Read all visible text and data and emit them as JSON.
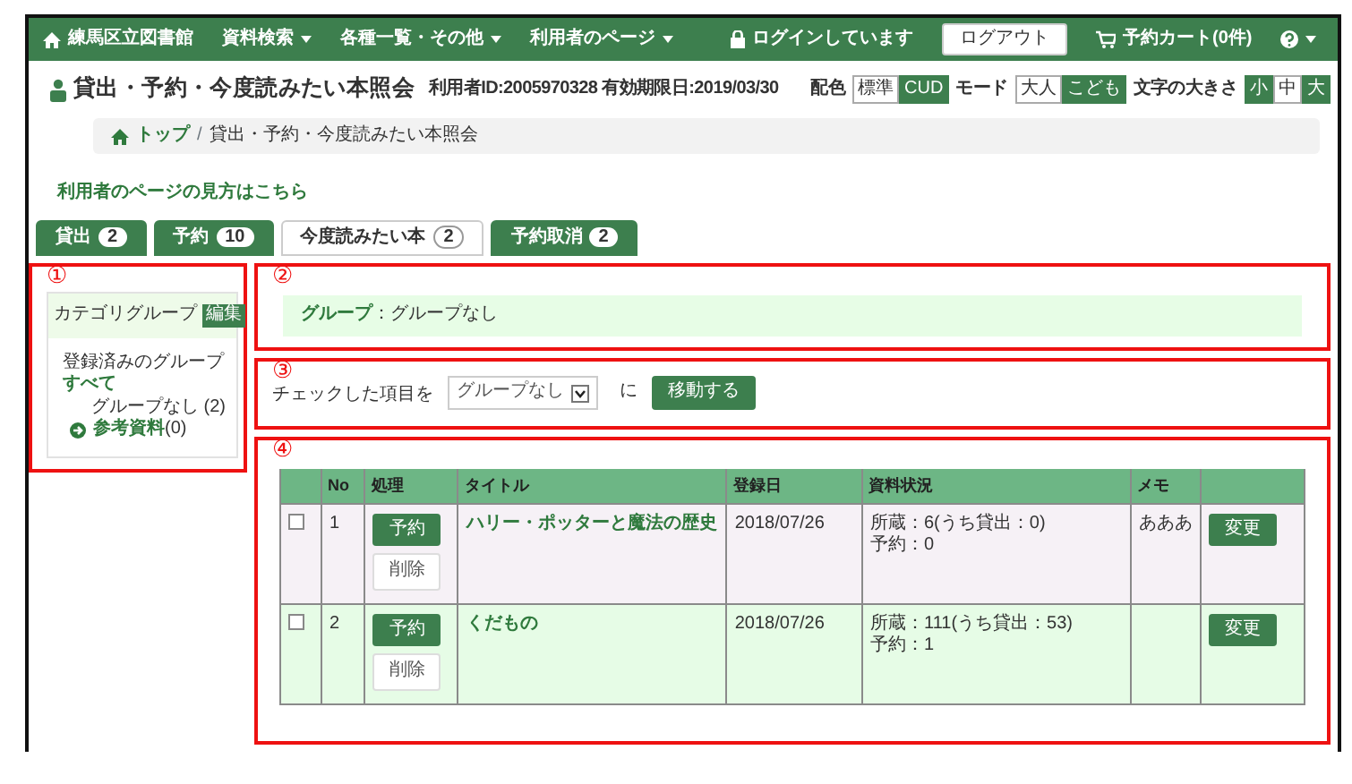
{
  "navbar": {
    "brand": "練馬区立図書館",
    "menus": [
      {
        "label": "資料検索"
      },
      {
        "label": "各種一覧・その他"
      },
      {
        "label": "利用者のページ"
      }
    ],
    "login_status": "ログインしています",
    "logout_button": "ログアウト",
    "cart": "予約カート(0件)"
  },
  "header": {
    "title": "貸出・予約・今度読みたい本照会",
    "user_info": "利用者ID:2005970328 有効期限日:2019/03/30",
    "settings": [
      {
        "label": "配色",
        "options": [
          {
            "label": "標準",
            "selected": false
          },
          {
            "label": "CUD",
            "selected": true
          }
        ]
      },
      {
        "label": "モード",
        "options": [
          {
            "label": "大人",
            "selected": false
          },
          {
            "label": "こども",
            "selected": true
          }
        ]
      },
      {
        "label": "文字の大きさ",
        "options": [
          {
            "label": "小",
            "selected": true
          },
          {
            "label": "中",
            "selected": false
          },
          {
            "label": "大",
            "selected": true
          }
        ]
      }
    ]
  },
  "breadcrumb": [
    "トップ",
    "貸出・予約・今度読みたい本照会"
  ],
  "breadcrumb_separator": "/",
  "help_link": "利用者のページの見方はこちら",
  "tabs": [
    {
      "label": "貸出",
      "count": "2",
      "selected": false
    },
    {
      "label": "予約",
      "count": "10",
      "selected": false
    },
    {
      "label": "今度読みたい本",
      "count": "2",
      "selected": true
    },
    {
      "label": "予約取消",
      "count": "2",
      "selected": false
    }
  ],
  "sidebar": {
    "annotation": "①",
    "heading": "カテゴリグループ",
    "edit_button": "編集",
    "registered_label": "登録済みのグループ",
    "all_link": "すべて",
    "groups": [
      {
        "kind": "plain",
        "label": "グループなし (2)"
      },
      {
        "kind": "link",
        "label": "参考資料",
        "count": "(0)"
      }
    ]
  },
  "group_bar": {
    "annotation": "②",
    "label": "グループ",
    "value": "：グループなし"
  },
  "move": {
    "annotation": "③",
    "label": "チェックした項目を",
    "select": "グループなし",
    "suffix": "に",
    "button": "移動する"
  },
  "table": {
    "annotation": "④",
    "columns": [
      "No",
      "処理",
      "タイトル",
      "登録日",
      "資料状況",
      "メモ"
    ],
    "rows": [
      {
        "checked": false,
        "no": "1",
        "reserve_button": "予約",
        "delete_button": "削除",
        "title": "ハリー・ポッターと魔法の歴史",
        "date": "2018/07/26",
        "status": [
          "所蔵：6(うち貸出：0)",
          "予約：0"
        ],
        "memo": "あああ",
        "change_button": "変更"
      },
      {
        "checked": false,
        "no": "2",
        "reserve_button": "予約",
        "delete_button": "削除",
        "title": "くだもの",
        "date": "2018/07/26",
        "status": [
          "所蔵：111(うち貸出：53)",
          "予約：1"
        ],
        "change_button": "変更"
      }
    ]
  }
}
